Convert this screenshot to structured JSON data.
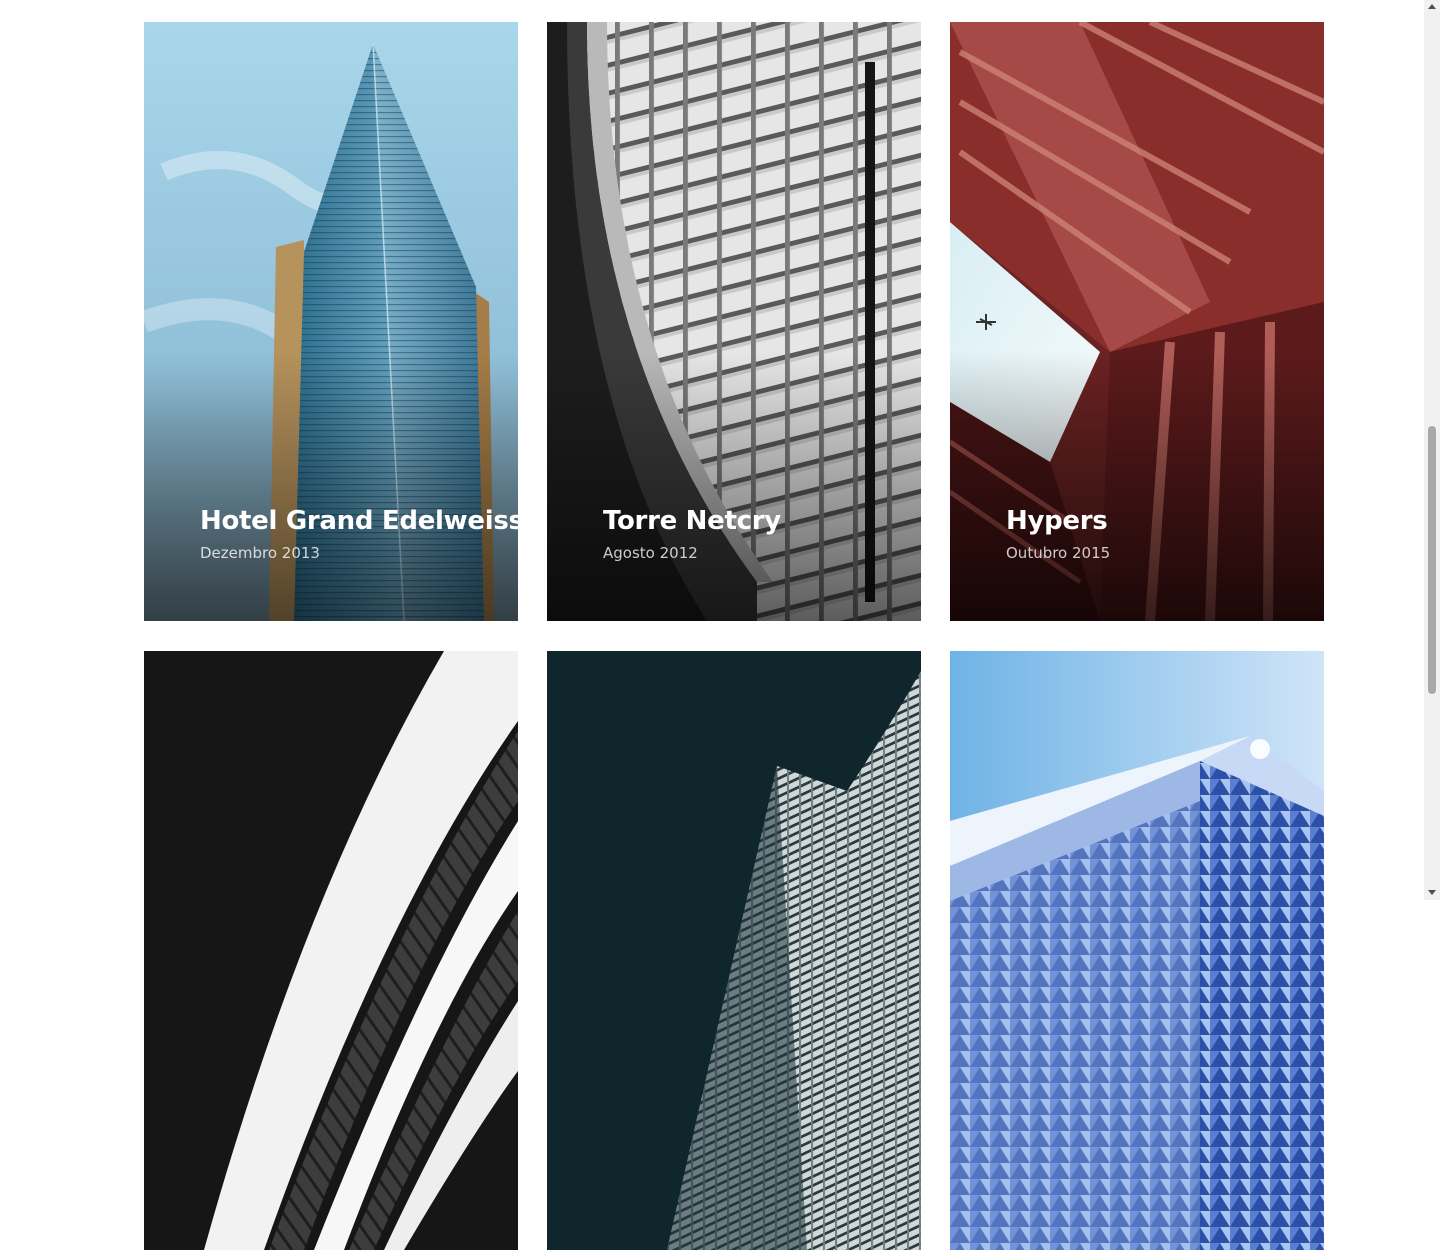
{
  "projects": [
    {
      "title": "Hotel Grand Edelweiss",
      "date": "Dezembro 2013",
      "image": "blue-glass-tower"
    },
    {
      "title": "Torre Netcry",
      "date": "Agosto 2012",
      "image": "white-lattice-facade"
    },
    {
      "title": "Hypers",
      "date": "Outubro 2015",
      "image": "red-courtyard-upward"
    },
    {
      "title": "",
      "date": "",
      "image": "curved-louvered-facade"
    },
    {
      "title": "",
      "date": "",
      "image": "dark-teal-wave-tower"
    },
    {
      "title": "",
      "date": "",
      "image": "blue-triangular-glass-building"
    }
  ],
  "colors": {
    "overlay": "#000000",
    "caption_text": "#ffffff"
  }
}
